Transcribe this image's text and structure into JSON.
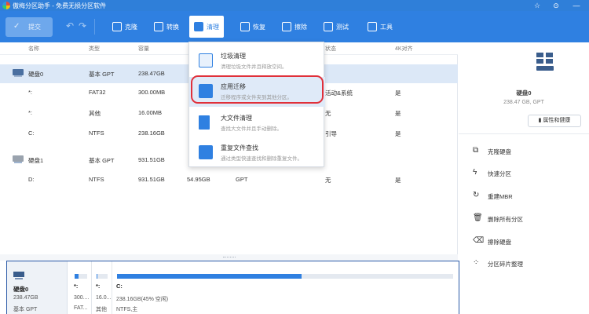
{
  "window": {
    "title": "傲梅分区助手 - 免费无损分区软件",
    "controls": [
      "☆",
      "⊙",
      "—"
    ]
  },
  "toolbar": {
    "submit_label": "提交",
    "buttons": [
      {
        "label": "克隆",
        "icon": "clone-icon"
      },
      {
        "label": "转换",
        "icon": "convert-icon"
      },
      {
        "label": "清理",
        "icon": "cleanup-icon",
        "active": true
      },
      {
        "label": "恢复",
        "icon": "recover-icon"
      },
      {
        "label": "擦除",
        "icon": "wipe-icon"
      },
      {
        "label": "测试",
        "icon": "test-icon"
      },
      {
        "label": "工具",
        "icon": "tools-icon"
      }
    ]
  },
  "table": {
    "headers": [
      "名称",
      "类型",
      "容量",
      "状态",
      "4K对齐"
    ],
    "rows": [
      {
        "name": "硬盘0",
        "type": "基本 GPT",
        "capacity": "238.47GB",
        "used": "",
        "fs": "",
        "status": "",
        "align": "",
        "disk": true,
        "selected": true
      },
      {
        "name": "*:",
        "type": "FAT32",
        "capacity": "300.00MB",
        "used": "",
        "fs": "",
        "status": "活动&系统",
        "align": "是"
      },
      {
        "name": "*:",
        "type": "其他",
        "capacity": "16.00MB",
        "used": "",
        "fs": "",
        "status": "无",
        "align": "是"
      },
      {
        "name": "C:",
        "type": "NTFS",
        "capacity": "238.16GB",
        "used": "",
        "fs": "",
        "status": "引导",
        "align": "是"
      },
      {
        "name": "硬盘1",
        "type": "基本 GPT",
        "capacity": "931.51GB",
        "used": "",
        "fs": "",
        "status": "",
        "align": "",
        "disk": true
      },
      {
        "name": "D:",
        "type": "NTFS",
        "capacity": "931.51GB",
        "used": "54.95GB",
        "fs": "GPT",
        "status": "无",
        "align": "是"
      }
    ]
  },
  "menu": {
    "items": [
      {
        "title": "垃圾清理",
        "desc": "清理垃圾文件并且释放空间。",
        "icon": "broom-icon",
        "color": "#2f80e1"
      },
      {
        "title": "应用迁移",
        "desc": "迁移程序或文件夹到其他分区。",
        "icon": "app-move-icon",
        "color": "#2f80e1",
        "highlighted": true
      },
      {
        "title": "大文件清理",
        "desc": "查找大文件并且手动删除。",
        "icon": "large-file-icon",
        "color": "#2f80e1"
      },
      {
        "title": "重复文件查找",
        "desc": "通过类型快速查找和删除重复文件。",
        "icon": "duplicate-file-icon",
        "color": "#2f80e1"
      }
    ]
  },
  "right_panel": {
    "disk_name": "硬盘0",
    "disk_info": "238.47 GB, GPT",
    "properties_label": "属性和健康",
    "actions": [
      {
        "label": "克隆硬盘",
        "icon": "clone-disk-icon",
        "glyph": "⧉"
      },
      {
        "label": "快速分区",
        "icon": "quick-partition-icon",
        "glyph": "ϟ"
      },
      {
        "label": "重建MBR",
        "icon": "rebuild-mbr-icon",
        "glyph": "↻"
      },
      {
        "label": "删除所有分区",
        "icon": "delete-partitions-icon",
        "glyph": "🗑"
      },
      {
        "label": "擦除硬盘",
        "icon": "erase-disk-icon",
        "glyph": "⌫"
      },
      {
        "label": "分区碎片整理",
        "icon": "defrag-icon",
        "glyph": "⁘"
      }
    ]
  },
  "disk_map": {
    "disk": {
      "name": "硬盘0",
      "size": "238.47GB",
      "type": "基本 GPT"
    },
    "partitions": [
      {
        "label": "*:",
        "size": "300....",
        "fs": "FAT...",
        "fill": 0.3
      },
      {
        "label": "*:",
        "size": "16.0...",
        "fs": "其他",
        "fill": 0.1
      },
      {
        "label": "C:",
        "size": "238.16GB(45% 空闲)",
        "fs": "NTFS,主",
        "fill": 0.55
      }
    ]
  }
}
